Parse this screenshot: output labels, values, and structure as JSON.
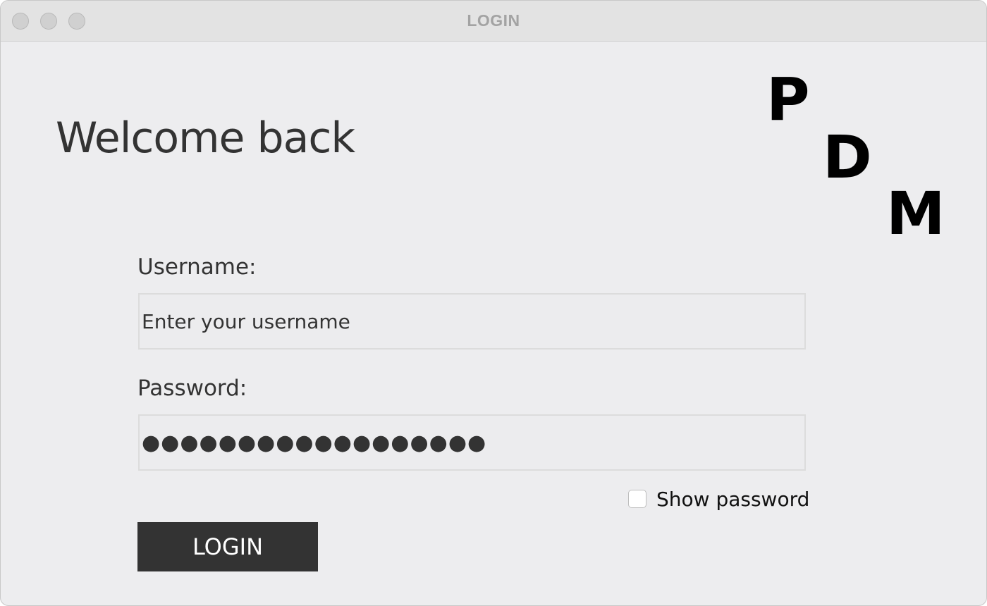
{
  "window": {
    "title": "LOGIN"
  },
  "main": {
    "heading": "Welcome back",
    "logo_letters": [
      "P",
      "D",
      "M"
    ]
  },
  "form": {
    "username_label": "Username:",
    "username_placeholder": "Enter your username",
    "username_value": "",
    "password_label": "Password:",
    "password_masked": "●●●●●●●●●●●●●●●●●●",
    "show_password_label": "Show password",
    "show_password_checked": false,
    "login_label": "LOGIN"
  },
  "colors": {
    "window_bg": "#ededef",
    "button_bg": "#333333",
    "text": "#333333"
  }
}
